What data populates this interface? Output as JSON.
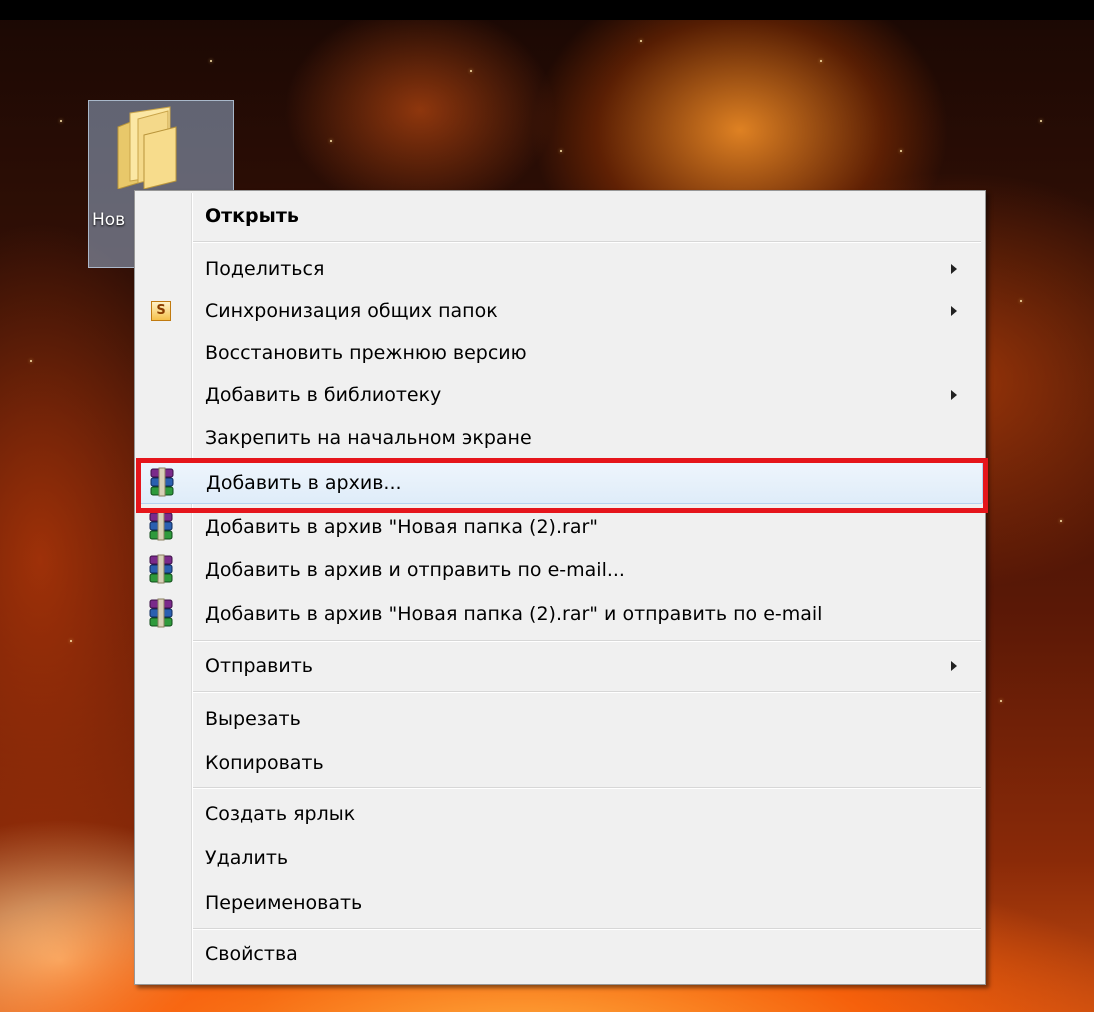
{
  "desktop": {
    "folder_label": "Нов"
  },
  "context_menu": {
    "items": [
      {
        "label": "Открыть",
        "bold": true
      },
      {
        "label": "Поделиться",
        "submenu": true
      },
      {
        "label": "Синхронизация общих папок",
        "submenu": true,
        "icon": "sync-folders-icon"
      },
      {
        "label": "Восстановить прежнюю версию"
      },
      {
        "label": "Добавить в библиотеку",
        "submenu": true
      },
      {
        "label": "Закрепить на начальном экране"
      },
      {
        "label": "Добавить в архив...",
        "icon": "winrar-icon",
        "highlighted": true
      },
      {
        "label": "Добавить в архив \"Новая папка (2).rar\"",
        "icon": "winrar-icon"
      },
      {
        "label": "Добавить в архив и отправить по e-mail...",
        "icon": "winrar-icon"
      },
      {
        "label": "Добавить в архив \"Новая папка (2).rar\" и отправить по e-mail",
        "icon": "winrar-icon"
      },
      {
        "label": "Отправить",
        "submenu": true
      },
      {
        "label": "Вырезать"
      },
      {
        "label": "Копировать"
      },
      {
        "label": "Создать ярлык"
      },
      {
        "label": "Удалить"
      },
      {
        "label": "Переименовать"
      },
      {
        "label": "Свойства"
      }
    ],
    "sync_icon_letter": "S",
    "highlight_color": "#e5151b"
  }
}
